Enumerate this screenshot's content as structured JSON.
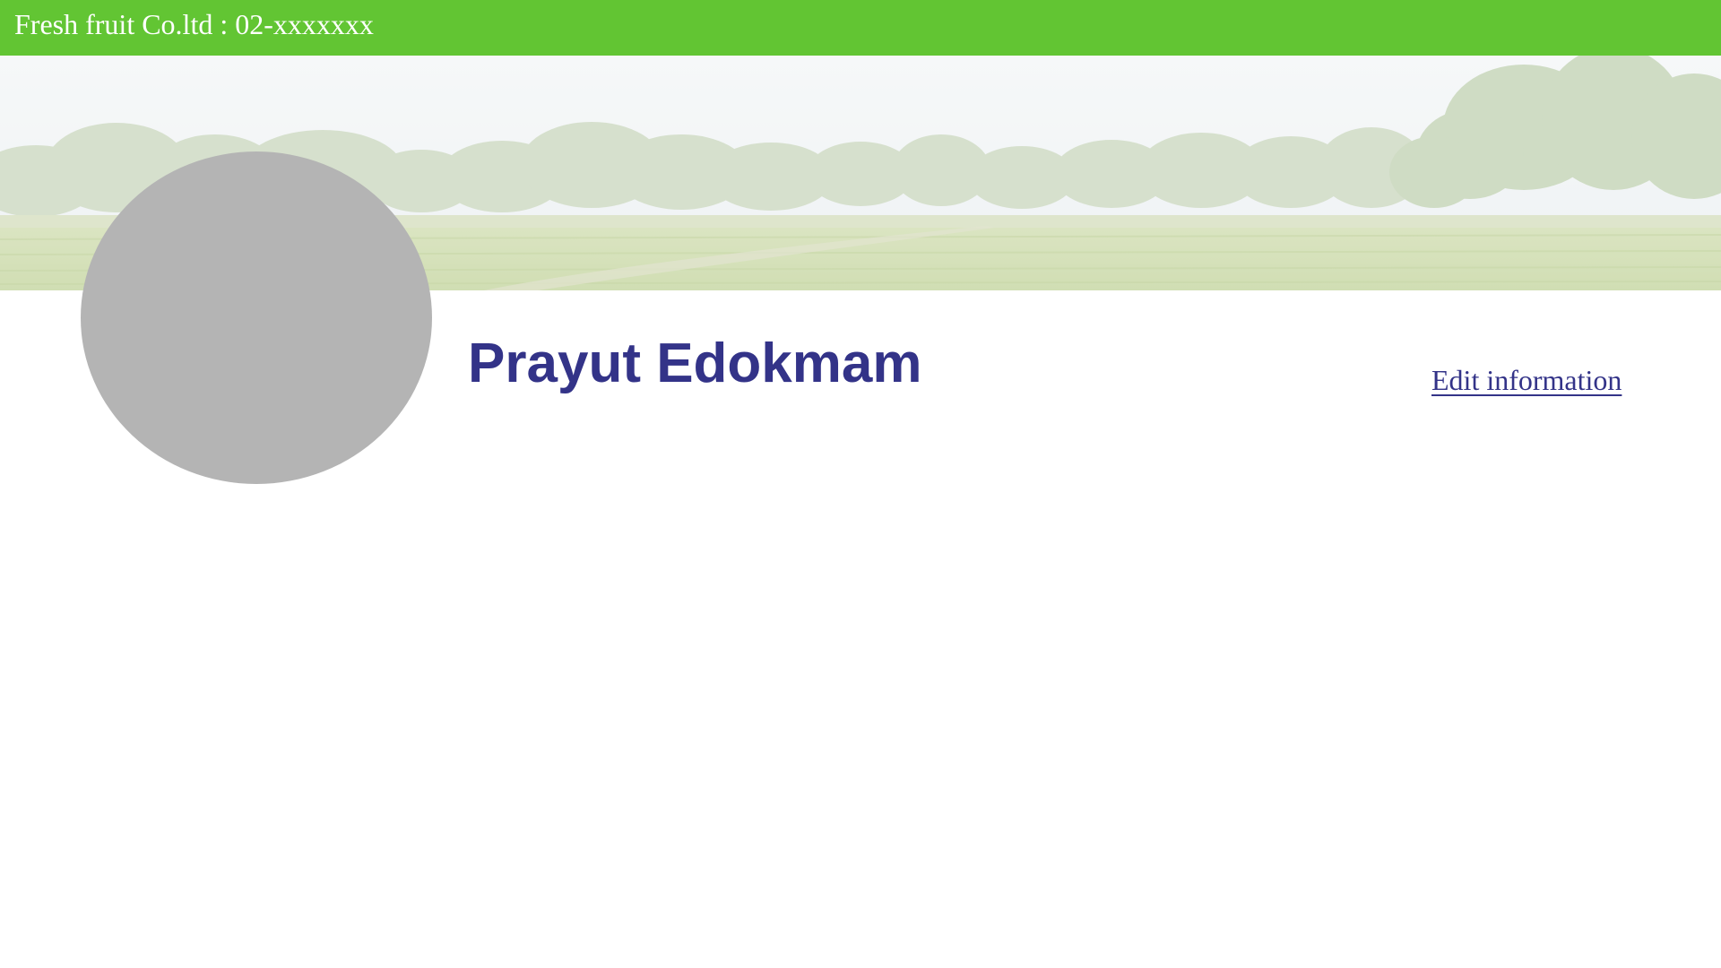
{
  "header": {
    "company_text": "Fresh fruit Co.ltd : 02-xxxxxxx",
    "background_color": "#62c533"
  },
  "banner": {
    "image": "farm-field-banner"
  },
  "profile": {
    "avatar_color": "#b4b4b4",
    "name": "Prayut Edokmam",
    "name_color": "#333388",
    "edit_link_label": "Edit information"
  }
}
